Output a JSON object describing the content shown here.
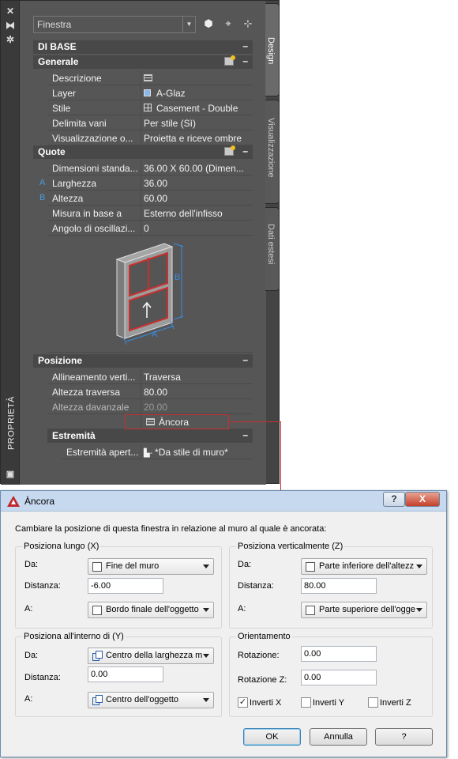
{
  "palette": {
    "title": "PROPRIETÀ",
    "object_type": "Finestra",
    "tabs": [
      "Design",
      "Visualizzazione",
      "Dati estesi"
    ],
    "sections": {
      "base": "DI BASE",
      "generale": "Generale",
      "quote": "Quote",
      "posizione": "Posizione",
      "estremita": "Estremità"
    },
    "generale": [
      {
        "label": "Descrizione",
        "value": ""
      },
      {
        "label": "Layer",
        "value": "A-Glaz"
      },
      {
        "label": "Stile",
        "value": "Casement - Double"
      },
      {
        "label": "Delimita vani",
        "value": "Per stile (Sì)"
      },
      {
        "label": "Visualizzazione  o...",
        "value": "Proietta e riceve ombre"
      }
    ],
    "quote": [
      {
        "mark": "",
        "label": "Dimensioni  standa...",
        "value": "36.00  X  60.00 (Dimen..."
      },
      {
        "mark": "A",
        "label": "Larghezza",
        "value": "36.00"
      },
      {
        "mark": "B",
        "label": "Altezza",
        "value": "60.00"
      },
      {
        "mark": "",
        "label": "Misura in base a",
        "value": "Esterno dell'infisso"
      },
      {
        "mark": "",
        "label": "Angolo di  oscillazi...",
        "value": "0"
      }
    ],
    "preview_labels": {
      "a": "A",
      "b": "B"
    },
    "posizione": [
      {
        "label": "Allineamento  verti...",
        "value": "Traversa"
      },
      {
        "label": "Altezza traversa",
        "value": "80.00"
      },
      {
        "label": "Altezza davanzale",
        "value": "20.00"
      }
    ],
    "ancora_label": "Àncora",
    "estremita": {
      "label": "Estremità  apert...",
      "value": "*Da stile di muro*"
    }
  },
  "dialog": {
    "title": "Àncora",
    "help_glyph": "?",
    "close_glyph": "X",
    "description": "Cambiare la posizione di questa finestra in relazione al muro al quale è ancorata:",
    "lungo": {
      "legend": "Posiziona lungo (X)",
      "da_label": "Da:",
      "da_value": "Fine del muro",
      "distanza_label": "Distanza:",
      "distanza_value": "-6.00",
      "a_label": "A:",
      "a_value": "Bordo finale dell'oggetto"
    },
    "verticale": {
      "legend": "Posiziona verticalmente (Z)",
      "da_label": "Da:",
      "da_value": "Parte inferiore dell'altezz",
      "distanza_label": "Distanza:",
      "distanza_value": "80.00",
      "a_label": "A:",
      "a_value": "Parte superiore dell'ogge"
    },
    "interno": {
      "legend": "Posiziona all'interno di (Y)",
      "da_label": "Da:",
      "da_value": "Centro della larghezza m",
      "distanza_label": "Distanza:",
      "distanza_value": "0.00",
      "a_label": "A:",
      "a_value": "Centro dell'oggetto"
    },
    "orientamento": {
      "legend": "Orientamento",
      "rotazione_label": "Rotazione:",
      "rotazione_value": "0.00",
      "rotazione_z_label": "Rotazione Z:",
      "rotazione_z_value": "0.00",
      "inverti_x": "Inverti X",
      "inverti_x_checked": true,
      "inverti_y": "Inverti Y",
      "inverti_y_checked": false,
      "inverti_z": "Inverti Z",
      "inverti_z_checked": false
    },
    "buttons": {
      "ok": "OK",
      "annulla": "Annulla",
      "help": "?"
    }
  },
  "colors": {
    "highlight": "#c83030",
    "dim_mark": "#4a9ae0"
  }
}
